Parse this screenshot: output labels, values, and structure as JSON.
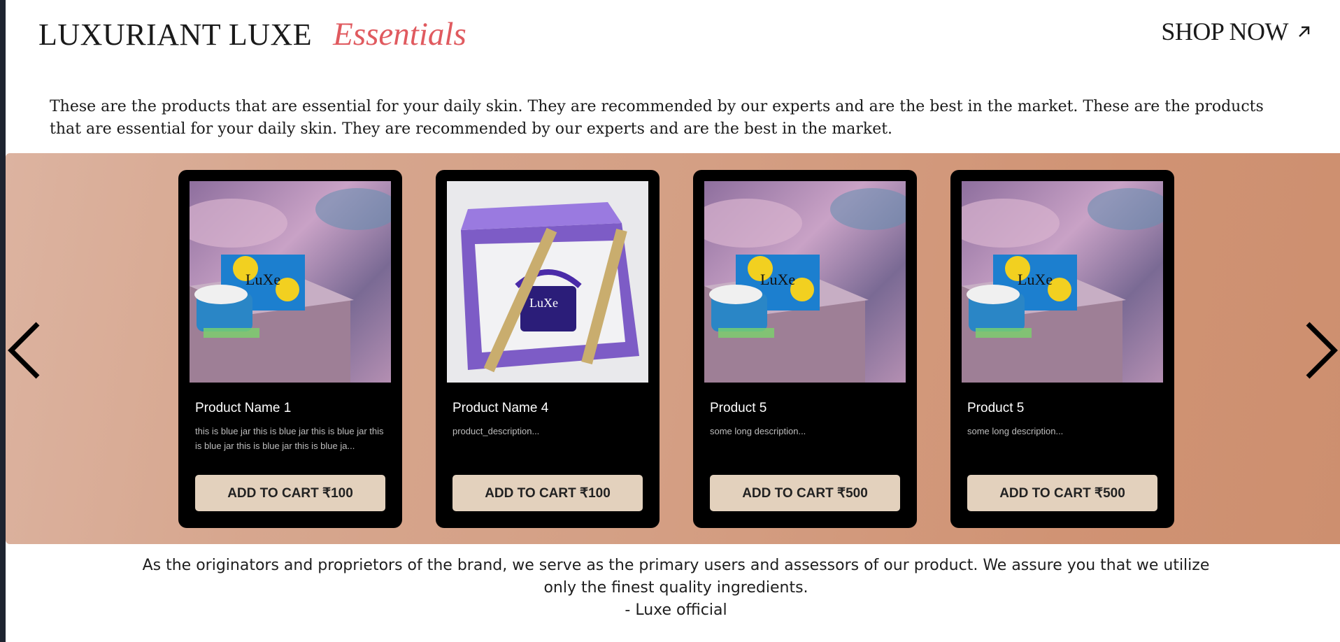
{
  "header": {
    "brand": "LUXURIANT LUXE",
    "brand_accent": "Essentials",
    "shop_now": "SHOP NOW"
  },
  "intro": "These are the products that are essential for your daily skin. They are recommended by our experts and are the best in the market. These are the products that are essential for your daily skin. They are recommended by our experts and are the best in the market.",
  "carousel": {
    "prev_icon": "chevron-left-icon",
    "next_icon": "chevron-right-icon",
    "products": [
      {
        "name": "Product Name 1",
        "description": "this is blue jar this is blue jar this is blue jar this is blue jar this is blue jar this is blue ja...",
        "button": "ADD TO CART ₹100"
      },
      {
        "name": "Product Name 4",
        "description": "product_description...",
        "button": "ADD TO CART ₹100"
      },
      {
        "name": "Product 5",
        "description": "some long description...",
        "button": "ADD TO CART ₹500"
      },
      {
        "name": "Product 5",
        "description": "some long description...",
        "button": "ADD TO CART ₹500"
      }
    ]
  },
  "quote": {
    "line1": "As the originators and proprietors of the brand, we serve as the primary users and assessors of our product. We assure you that we utilize only the finest quality ingredients.",
    "attribution": "- Luxe official"
  },
  "colors": {
    "accent": "#e05a5f",
    "carousel_bg": "#d49f84",
    "card_bg": "#000000",
    "button_bg": "#e3d1bd"
  }
}
